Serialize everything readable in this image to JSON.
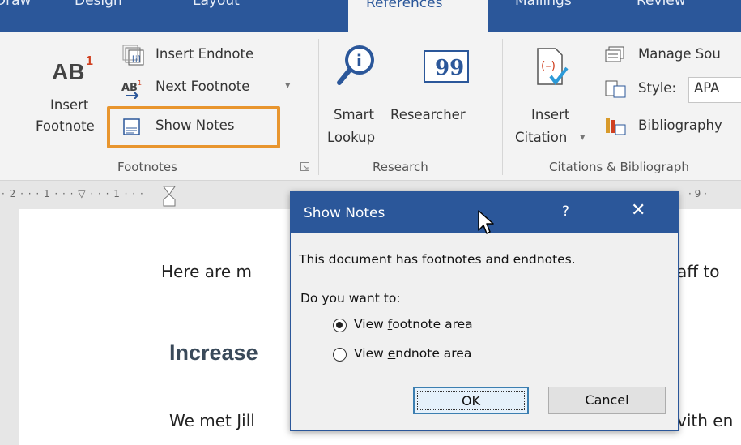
{
  "ribbon": {
    "tabs": [
      "Draw",
      "Design",
      "Layout",
      "References",
      "Mailings",
      "Review"
    ],
    "active_tab": "References",
    "footnotes": {
      "insert_footnote_l1": "Insert",
      "insert_footnote_l2": "Footnote",
      "insert_endnote": "Insert Endnote",
      "next_footnote": "Next Footnote",
      "show_notes": "Show Notes",
      "group_label": "Footnotes"
    },
    "research": {
      "smart_lookup_l1": "Smart",
      "smart_lookup_l2": "Lookup",
      "researcher": "Researcher",
      "group_label": "Research"
    },
    "citations": {
      "insert_citation_l1": "Insert",
      "insert_citation_l2": "Citation",
      "manage_sources": "Manage Sou",
      "style_label": "Style:",
      "style_value": "APA",
      "bibliography": "Bibliography",
      "group_label": "Citations & Bibliograph"
    }
  },
  "ruler": {
    "text": "· 2 · · · 1 · · · ▽ · · · 1 · · ·",
    "right_text": "· 9 ·"
  },
  "document": {
    "line1": "Here are m",
    "line1_right": "aff to",
    "heading": "Increase",
    "line2": "We met Jill",
    "line2_right": "vith en"
  },
  "dialog": {
    "title": "Show Notes",
    "help": "?",
    "close": "✕",
    "message": "This document has footnotes and endnotes.",
    "question": "Do you want to:",
    "option1_pre": "View ",
    "option1_u": "f",
    "option1_post": "ootnote area",
    "option2_pre": "View ",
    "option2_u": "e",
    "option2_post": "ndnote area",
    "selected": "footnote",
    "ok": "OK",
    "cancel": "Cancel"
  },
  "colors": {
    "accent": "#2b579a",
    "highlight": "#e8952e"
  }
}
